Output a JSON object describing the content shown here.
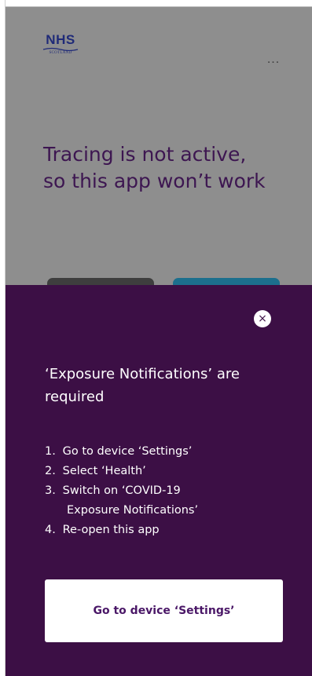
{
  "background_app": {
    "logo": {
      "main": "NHS",
      "sub": "SCOTLAND"
    },
    "more_menu_label": "...",
    "headline_line1": "Tracing is not active,",
    "headline_line2": "so this app won’t work"
  },
  "sheet": {
    "close_glyph": "×",
    "title_line1": "‘Exposure Notifications’ are",
    "title_line2": "required",
    "steps": [
      {
        "num": "1.",
        "text": "Go to device ‘Settings’"
      },
      {
        "num": "2.",
        "text": "Select ‘Health’"
      },
      {
        "num": "3.",
        "text": "Switch on ‘COVID-19",
        "text_cont": "Exposure Notifications’"
      },
      {
        "num": "4.",
        "text": "Re-open this app"
      }
    ],
    "button_label": "Go to device ‘Settings’"
  },
  "colors": {
    "sheet_background": "#3c0f45",
    "headline": "#3d1651",
    "logo": "#1f2a78",
    "button_text": "#4a1767",
    "dim_overlay": "#8e8e8e"
  },
  "icons": {
    "close": "close-icon",
    "more": "more-dots-icon"
  }
}
